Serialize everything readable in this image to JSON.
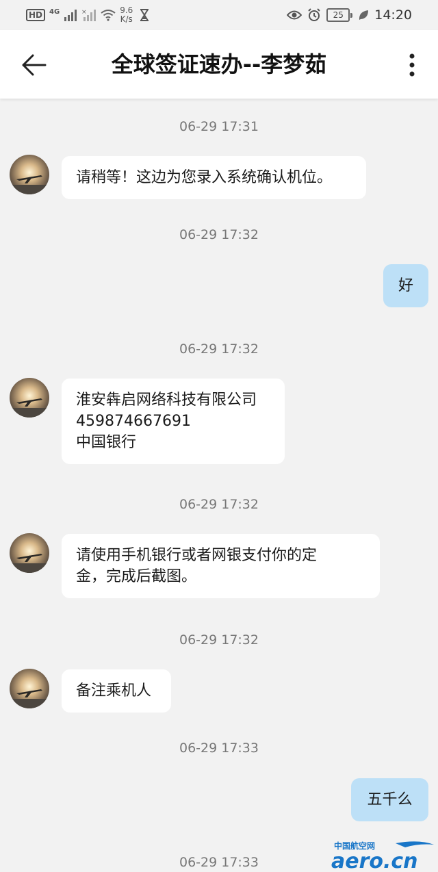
{
  "status_bar": {
    "hd": "HD",
    "network": "4G",
    "speed_value": "9.6",
    "speed_unit": "K/s",
    "battery": "25",
    "time": "14:20"
  },
  "header": {
    "title": "全球签证速办--李梦茹"
  },
  "messages": [
    {
      "time": "06-29 17:31",
      "text": "请稍等！这边为您录入系统确认机位。"
    },
    {
      "time": "06-29 17:32",
      "text": "好"
    },
    {
      "time": "06-29 17:32",
      "text": "淮安犇启网络科技有限公司\n459874667691\n中国银行"
    },
    {
      "time": "06-29 17:32",
      "text": "请使用手机银行或者网银支付你的定\n金，完成后截图。"
    },
    {
      "time": "06-29 17:32",
      "text": "备注乘机人"
    },
    {
      "time": "06-29 17:33",
      "text": "五千么"
    },
    {
      "time": "06-29 17:33"
    }
  ],
  "watermark": {
    "top": "中国航空网",
    "main": "aero.cn"
  },
  "colors": {
    "background": "#f2f2f2",
    "incoming_bubble": "#ffffff",
    "outgoing_bubble": "#bde0f7",
    "watermark_blue": "#1976c8"
  }
}
